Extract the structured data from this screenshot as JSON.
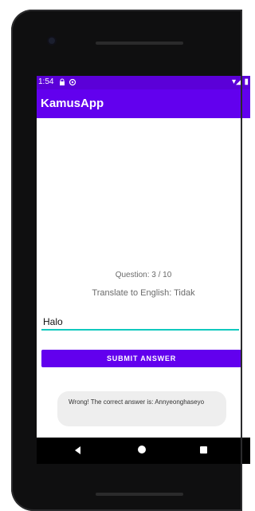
{
  "status_bar": {
    "time": "1:54",
    "icons": {
      "lock": "lock-icon",
      "app_notification": "notification-icon",
      "wifi": "wifi-icon",
      "signal": "signal-icon",
      "battery": "battery-icon"
    }
  },
  "app_bar": {
    "title": "KamusApp"
  },
  "quiz": {
    "question_label": "Question: 3 / 10",
    "prompt": "Translate to English: Tidak",
    "answer_value": "Halo",
    "submit_label": "SUBMIT ANSWER"
  },
  "toast": {
    "message": "Wrong! The correct answer is: Annyeonghaseyo"
  },
  "nav": {
    "back": "back-icon",
    "home": "home-icon",
    "recents": "recents-icon"
  },
  "colors": {
    "primary": "#6200ee",
    "status": "#5b00d8",
    "accent": "#10c9be"
  }
}
